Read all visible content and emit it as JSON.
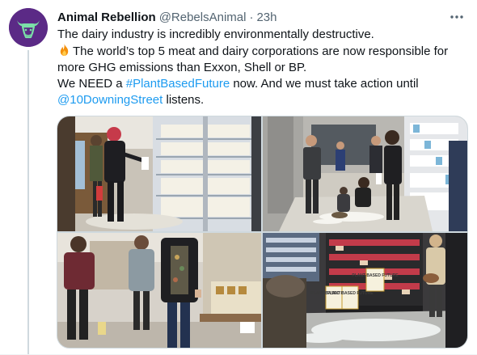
{
  "tweet": {
    "author_name": "Animal Rebellion",
    "author_handle": "@RebelsAnimal",
    "separator": "·",
    "timestamp": "23h",
    "lines": {
      "l1": "The dairy industry is incredibly environmentally destructive.",
      "l2": "The world’s top 5 meat and dairy corporations are now responsible for",
      "l3": "more GHG emissions than Exxon, Shell or BP.",
      "l4_pre": "We NEED a ",
      "l4_hashtag": "#PlantBasedFuture",
      "l4_post": " now. And we must take action until",
      "l5_mention": "@10DowningStreet",
      "l5_post": " listens."
    },
    "icons": {
      "avatar": "bull-logo-icon",
      "more": "more-dots-icon",
      "emoji": "fire-emoji-icon"
    }
  },
  "media": {
    "photo4_signs": {
      "sign1": "PLANT BASED FUTURE",
      "sign2": "PLANT BASED FUTURE",
      "sign3": "PLANT BASED FUTURE"
    }
  },
  "colors": {
    "link": "#1d9bf0",
    "secondary_text": "#536471",
    "avatar_bg": "#5b2a86",
    "avatar_fg": "#7be0a8"
  }
}
